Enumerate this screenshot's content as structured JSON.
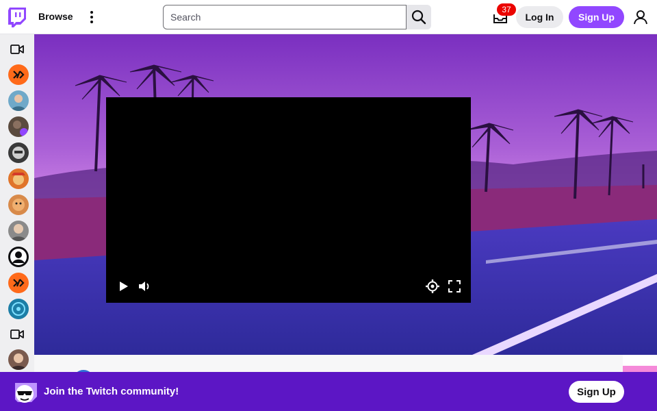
{
  "header": {
    "browse_label": "Browse",
    "search": {
      "placeholder": "Search",
      "value": ""
    },
    "inbox_badge": "37",
    "login_label": "Log In",
    "signup_label": "Sign Up"
  },
  "sidebar": {
    "items": [
      {
        "type": "icon",
        "icon": "video-camera-icon"
      },
      {
        "type": "avatar",
        "color": "#ff6a1a"
      },
      {
        "type": "avatar",
        "color": "#6fa9c9"
      },
      {
        "type": "avatar",
        "color": "#5a4a3e"
      },
      {
        "type": "avatar",
        "color": "#3a3a3a"
      },
      {
        "type": "avatar",
        "color": "#e0742a"
      },
      {
        "type": "avatar",
        "color": "#d88a4a"
      },
      {
        "type": "avatar",
        "color": "#8a8a8a"
      },
      {
        "type": "avatar",
        "color": "#0e0e10"
      },
      {
        "type": "avatar",
        "color": "#ff6a1a"
      },
      {
        "type": "avatar",
        "color": "#1c7ea6"
      },
      {
        "type": "icon",
        "icon": "video-camera-icon"
      },
      {
        "type": "avatar",
        "color": "#7a5a4e"
      }
    ]
  },
  "banner": {
    "text": "Join the Twitch community!",
    "signup_label": "Sign Up"
  },
  "colors": {
    "brand": "#9147ff",
    "banner": "#5c16c5",
    "badge": "#eb0400"
  }
}
